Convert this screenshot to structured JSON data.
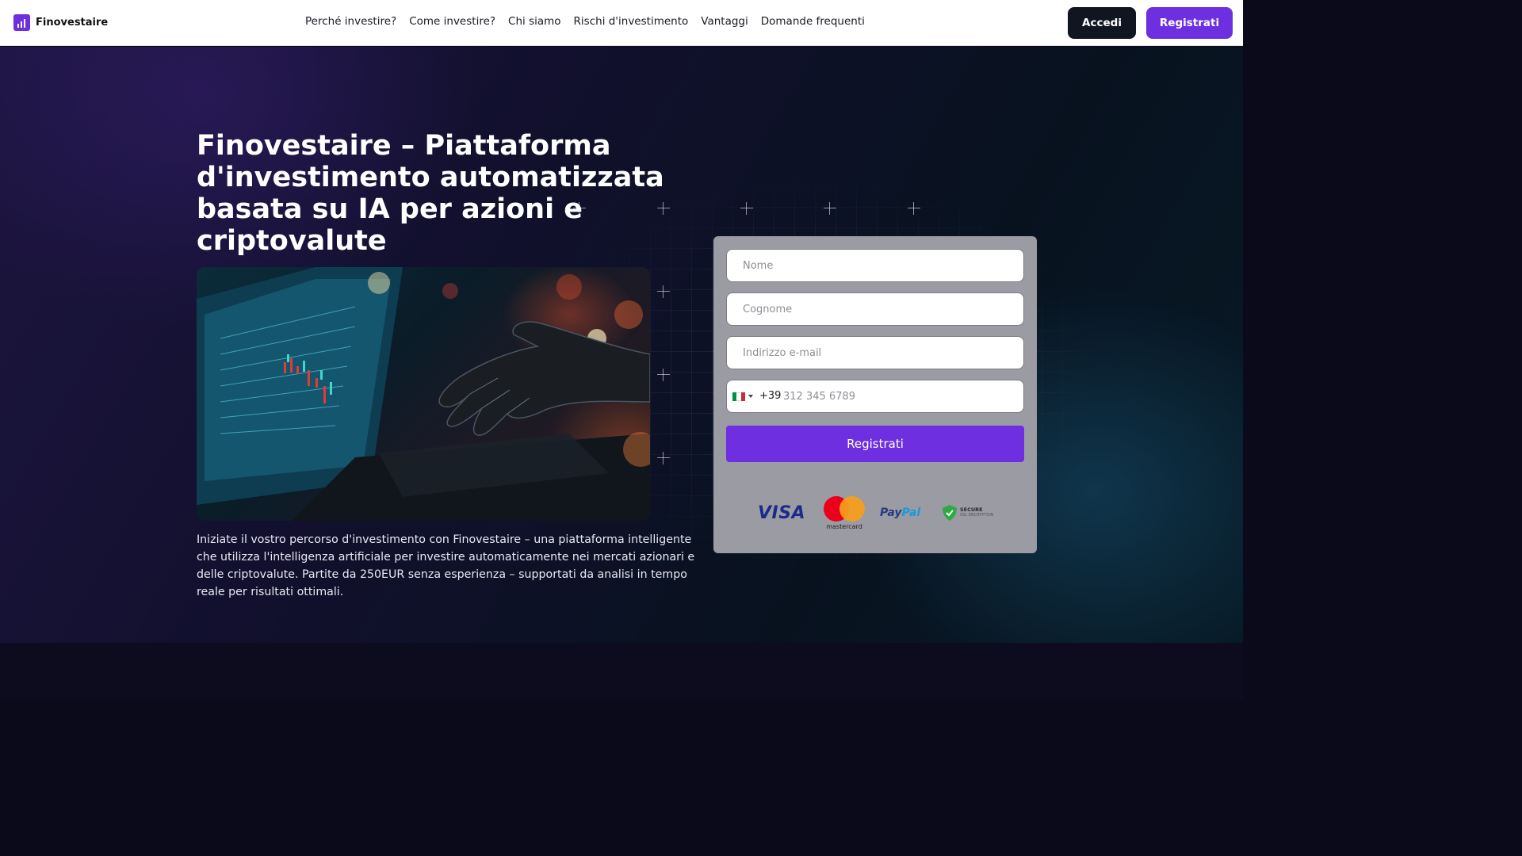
{
  "brand": {
    "name": "Finovestaire",
    "logo_icon": "bar-chart-icon",
    "accent": "#6d2fe0"
  },
  "nav": {
    "items": [
      "Perché investire?",
      "Come investire?",
      "Chi siamo",
      "Rischi d'investimento",
      "Vantaggi",
      "Domande frequenti"
    ],
    "login_label": "Accedi",
    "signup_label": "Registrati"
  },
  "hero": {
    "title": "Finovestaire – Piattaforma d'investimento automatizzata basata su IA per azioni e criptovalute",
    "image_icon": "robot-hand-laptop-image",
    "description": "Iniziate il vostro percorso d'investimento con Finovestaire – una piattaforma intelligente che utilizza l'intelligenza artificiale per investire automaticamente nei mercati azionari e delle criptovalute. Partite da 250EUR senza esperienza – supportati da analisi in tempo reale per risultati ottimali."
  },
  "form": {
    "first_name_placeholder": "Nome",
    "last_name_placeholder": "Cognome",
    "email_placeholder": "Indirizzo e-mail",
    "phone_prefix": "+39",
    "phone_placeholder": "312 345 6789",
    "phone_flag_icon": "italy-flag-icon",
    "submit_label": "Registrati",
    "payment_logos": {
      "visa": "VISA",
      "mastercard": "mastercard",
      "paypal_a": "Pay",
      "paypal_b": "Pal",
      "secure_title": "SECURE",
      "secure_sub": "SSL ENCRYPTION"
    }
  },
  "colors": {
    "button_dark": "#111521",
    "button_primary": "#6d2fe0",
    "form_bg": "#9a9ba3"
  }
}
